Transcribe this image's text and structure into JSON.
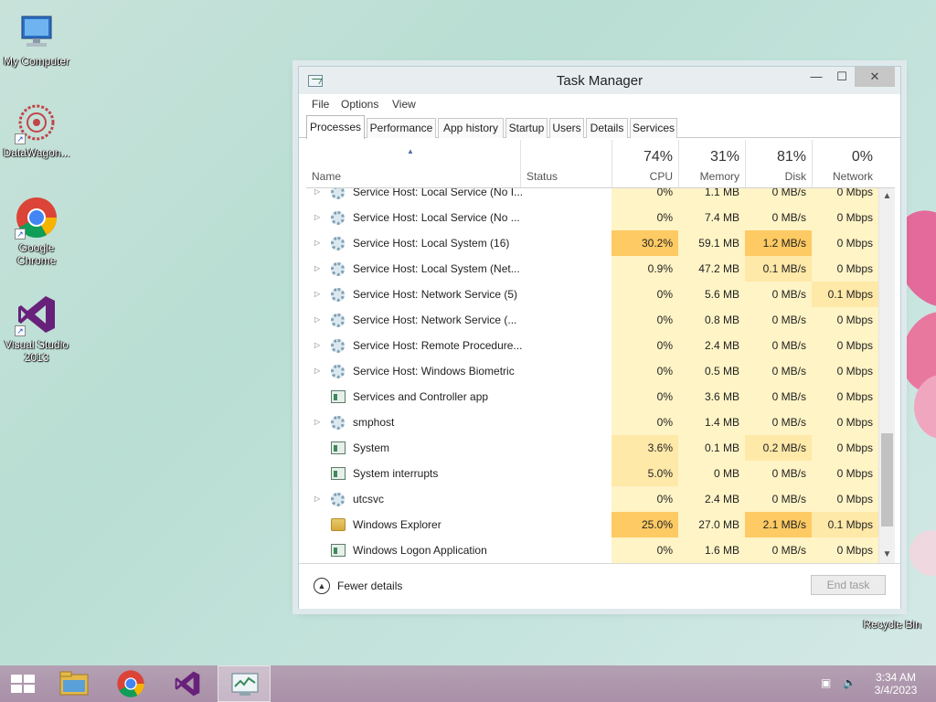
{
  "desktop": {
    "icons": [
      {
        "label": "My Computer"
      },
      {
        "label": "DataWagon..."
      },
      {
        "label": "Google Chrome"
      },
      {
        "label": "Visual Studio 2013"
      },
      {
        "label": "Recycle Bin"
      }
    ]
  },
  "window": {
    "title": "Task Manager",
    "menu": [
      "File",
      "Options",
      "View"
    ],
    "tabs": [
      "Processes",
      "Performance",
      "App history",
      "Startup",
      "Users",
      "Details",
      "Services"
    ],
    "active_tab": "Processes",
    "columns": {
      "name": "Name",
      "status": "Status",
      "cpu": {
        "percent": "74%",
        "label": "CPU"
      },
      "memory": {
        "percent": "31%",
        "label": "Memory"
      },
      "disk": {
        "percent": "81%",
        "label": "Disk"
      },
      "network": {
        "percent": "0%",
        "label": "Network"
      }
    },
    "rows": [
      {
        "name": "Service Host: Local Service (No I...",
        "cpu": "0%",
        "memory": "1.1 MB",
        "disk": "0 MB/s",
        "network": "0 Mbps",
        "icon": "gear-icon",
        "expandable": true
      },
      {
        "name": "Service Host: Local Service (No ...",
        "cpu": "0%",
        "memory": "7.4 MB",
        "disk": "0 MB/s",
        "network": "0 Mbps",
        "icon": "gear-icon",
        "expandable": true
      },
      {
        "name": "Service Host: Local System (16)",
        "cpu": "30.2%",
        "memory": "59.1 MB",
        "disk": "1.2 MB/s",
        "network": "0 Mbps",
        "icon": "gear-icon",
        "expandable": true
      },
      {
        "name": "Service Host: Local System (Net...",
        "cpu": "0.9%",
        "memory": "47.2 MB",
        "disk": "0.1 MB/s",
        "network": "0 Mbps",
        "icon": "gear-icon",
        "expandable": true
      },
      {
        "name": "Service Host: Network Service (5)",
        "cpu": "0%",
        "memory": "5.6 MB",
        "disk": "0 MB/s",
        "network": "0.1 Mbps",
        "icon": "gear-icon",
        "expandable": true
      },
      {
        "name": "Service Host: Network Service (...",
        "cpu": "0%",
        "memory": "0.8 MB",
        "disk": "0 MB/s",
        "network": "0 Mbps",
        "icon": "gear-icon",
        "expandable": true
      },
      {
        "name": "Service Host: Remote Procedure...",
        "cpu": "0%",
        "memory": "2.4 MB",
        "disk": "0 MB/s",
        "network": "0 Mbps",
        "icon": "gear-icon",
        "expandable": true
      },
      {
        "name": "Service Host: Windows Biometric",
        "cpu": "0%",
        "memory": "0.5 MB",
        "disk": "0 MB/s",
        "network": "0 Mbps",
        "icon": "gear-icon",
        "expandable": true
      },
      {
        "name": "Services and Controller app",
        "cpu": "0%",
        "memory": "3.6 MB",
        "disk": "0 MB/s",
        "network": "0 Mbps",
        "icon": "app-window-icon",
        "expandable": false
      },
      {
        "name": "smphost",
        "cpu": "0%",
        "memory": "1.4 MB",
        "disk": "0 MB/s",
        "network": "0 Mbps",
        "icon": "gear-icon",
        "expandable": true
      },
      {
        "name": "System",
        "cpu": "3.6%",
        "memory": "0.1 MB",
        "disk": "0.2 MB/s",
        "network": "0 Mbps",
        "icon": "app-window-icon",
        "expandable": false
      },
      {
        "name": "System interrupts",
        "cpu": "5.0%",
        "memory": "0 MB",
        "disk": "0 MB/s",
        "network": "0 Mbps",
        "icon": "app-window-icon",
        "expandable": false
      },
      {
        "name": "utcsvc",
        "cpu": "0%",
        "memory": "2.4 MB",
        "disk": "0 MB/s",
        "network": "0 Mbps",
        "icon": "gear-icon",
        "expandable": true
      },
      {
        "name": "Windows Explorer",
        "cpu": "25.0%",
        "memory": "27.0 MB",
        "disk": "2.1 MB/s",
        "network": "0.1 Mbps",
        "icon": "folder-icon",
        "expandable": false
      },
      {
        "name": "Windows Logon Application",
        "cpu": "0%",
        "memory": "1.6 MB",
        "disk": "0 MB/s",
        "network": "0 Mbps",
        "icon": "app-window-icon",
        "expandable": false
      }
    ],
    "footer": {
      "fewer_details": "Fewer details",
      "end_task": "End task"
    }
  },
  "taskbar": {
    "time": "3:34 AM",
    "date": "3/4/2023"
  },
  "colors": {
    "heat_low": "#fff4c6",
    "heat_mid": "#ffe9a8",
    "heat_high": "#fdca63",
    "taskbar": "#ad95ac"
  }
}
